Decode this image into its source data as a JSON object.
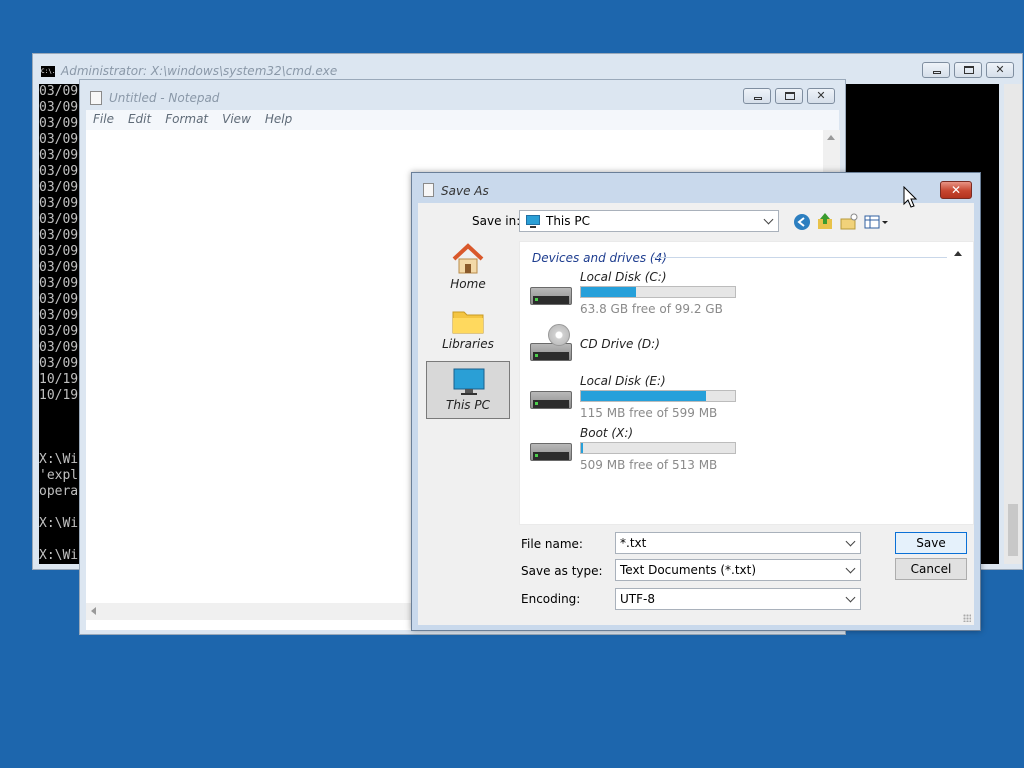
{
  "cmd": {
    "title": "Administrator: X:\\windows\\system32\\cmd.exe",
    "icon": "console-icon",
    "icon_text": "C:\\.",
    "lines": [
      "03/09",
      "03/09",
      "03/09",
      "03/09",
      "03/09",
      "03/09",
      "03/09",
      "03/09",
      "03/09",
      "03/09",
      "03/09",
      "03/09",
      "03/09",
      "03/09",
      "03/09",
      "03/09",
      "03/09",
      "03/09",
      "10/19",
      "10/19",
      "",
      "",
      "",
      "X:\\Wi",
      "'expl",
      "opera",
      "",
      "X:\\Wi",
      "",
      "X:\\Wi"
    ]
  },
  "notepad": {
    "title": "Untitled - Notepad",
    "menu": [
      "File",
      "Edit",
      "Format",
      "View",
      "Help"
    ]
  },
  "save_dialog": {
    "title": "Save As",
    "save_in_label": "Save in:",
    "save_in_value": "This PC",
    "toolbar_icons": [
      "back-icon",
      "up-folder-icon",
      "new-folder-icon",
      "view-menu-icon"
    ],
    "places": [
      {
        "label": "Home",
        "icon": "home-icon"
      },
      {
        "label": "Libraries",
        "icon": "libraries-folder-icon"
      },
      {
        "label": "This PC",
        "icon": "monitor-icon",
        "selected": true
      }
    ],
    "group_header": "Devices and drives (4)",
    "drives": [
      {
        "name": "Local Disk (C:)",
        "free": "63.8 GB free of 99.2 GB",
        "used_fraction": 0.36,
        "icon": "hard-drive-icon"
      },
      {
        "name": "CD Drive (D:)",
        "free": "",
        "used_fraction": null,
        "icon": "cd-drive-icon"
      },
      {
        "name": "Local Disk (E:)",
        "free": "115 MB free of 599 MB",
        "used_fraction": 0.81,
        "icon": "hard-drive-icon"
      },
      {
        "name": "Boot (X:)",
        "free": "509 MB free of 513 MB",
        "used_fraction": 0.01,
        "icon": "hard-drive-icon"
      }
    ],
    "file_name_label": "File name:",
    "file_name_value": "*.txt",
    "save_as_type_label": "Save as type:",
    "save_as_type_value": "Text Documents (*.txt)",
    "encoding_label": "Encoding:",
    "encoding_value": "UTF-8",
    "save_button": "Save",
    "cancel_button": "Cancel",
    "close_glyph": "✕"
  },
  "colors": {
    "desktop": "#1d66ad",
    "progress": "#26a0da",
    "group_header": "#1e3d8f"
  }
}
